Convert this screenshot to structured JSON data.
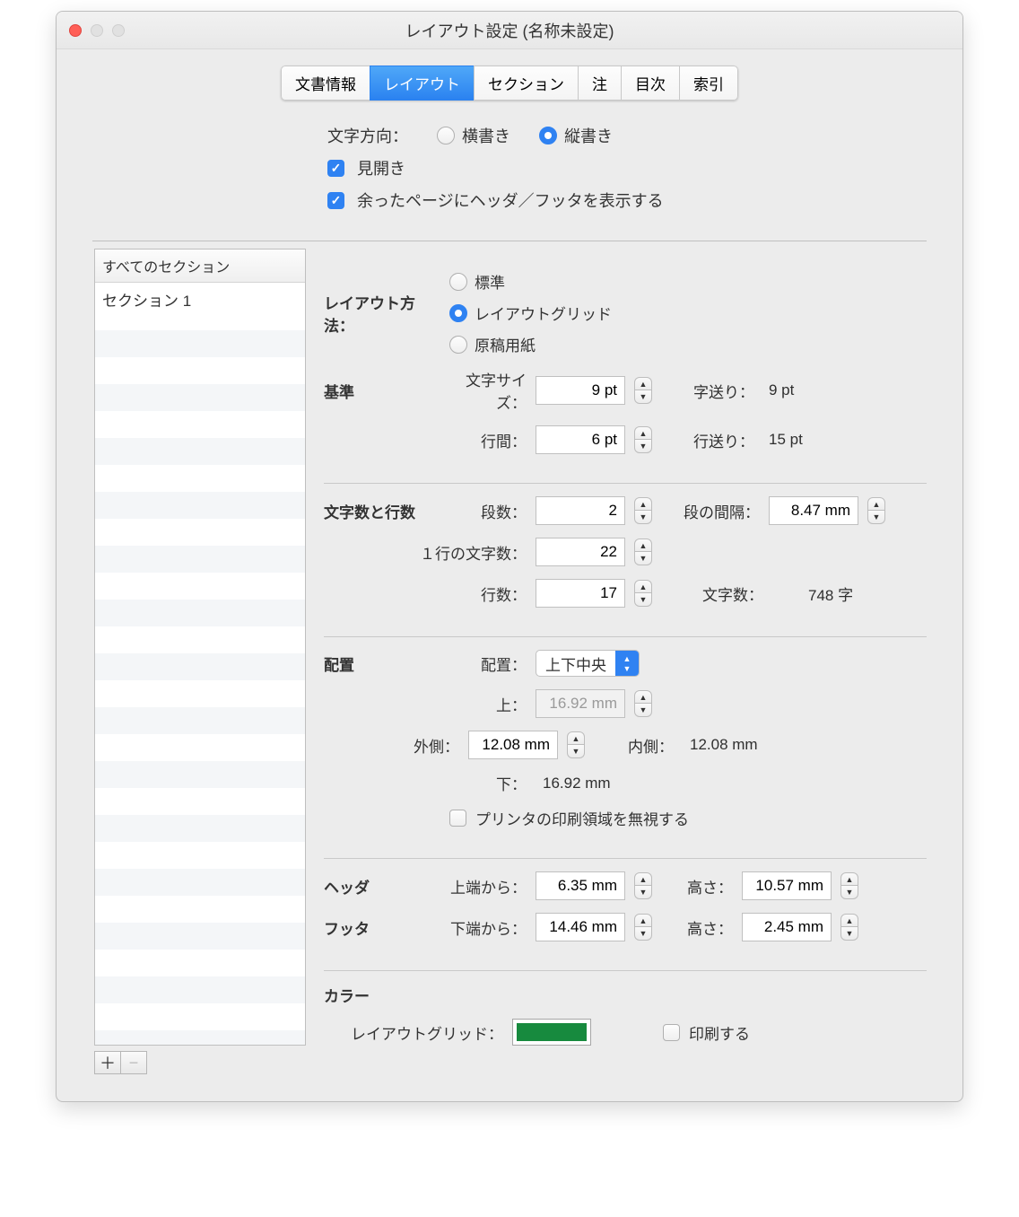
{
  "window": {
    "title": "レイアウト設定 (名称未設定)"
  },
  "tabs": {
    "doc_info": "文書情報",
    "layout": "レイアウト",
    "section": "セクション",
    "notes": "注",
    "toc": "目次",
    "index": "索引"
  },
  "direction": {
    "label": "文字方向：",
    "horizontal": "横書き",
    "vertical": "縦書き"
  },
  "facing_pages": "見開き",
  "show_hf_on_leftover": "余ったページにヘッダ／フッタを表示する",
  "sidebar": {
    "header": "すべてのセクション",
    "items": [
      "セクション 1"
    ]
  },
  "layout_method": {
    "label": "レイアウト方法：",
    "standard": "標準",
    "grid": "レイアウトグリッド",
    "manuscript": "原稿用紙"
  },
  "base": {
    "group": "基準",
    "font_size_label": "文字サイズ：",
    "font_size": "9 pt",
    "char_pitch_label": "字送り：",
    "char_pitch": "9 pt",
    "line_gap_label": "行間：",
    "line_gap": "6 pt",
    "line_pitch_label": "行送り：",
    "line_pitch": "15 pt"
  },
  "grid": {
    "group": "文字数と行数",
    "columns_label": "段数：",
    "columns": "2",
    "gutter_label": "段の間隔：",
    "gutter": "8.47 mm",
    "chars_label": "１行の文字数：",
    "chars": "22",
    "lines_label": "行数：",
    "lines": "17",
    "total_label": "文字数：",
    "total": "748  字"
  },
  "position": {
    "group": "配置",
    "align_label": "配置：",
    "align_value": "上下中央",
    "top_label": "上：",
    "top": "16.92 mm",
    "outer_label": "外側：",
    "outer": "12.08 mm",
    "inner_label": "内側：",
    "inner": "12.08 mm",
    "bottom_label": "下：",
    "bottom": "16.92 mm",
    "ignore_printer": "プリンタの印刷領域を無視する"
  },
  "header": {
    "group": "ヘッダ",
    "from_top_label": "上端から：",
    "from_top": "6.35 mm",
    "height_label": "高さ：",
    "height": "10.57 mm"
  },
  "footer": {
    "group": "フッタ",
    "from_bottom_label": "下端から：",
    "from_bottom": "14.46 mm",
    "height_label": "高さ：",
    "height": "2.45 mm"
  },
  "color": {
    "group": "カラー",
    "grid_label": "レイアウトグリッド：",
    "print_label": "印刷する"
  }
}
